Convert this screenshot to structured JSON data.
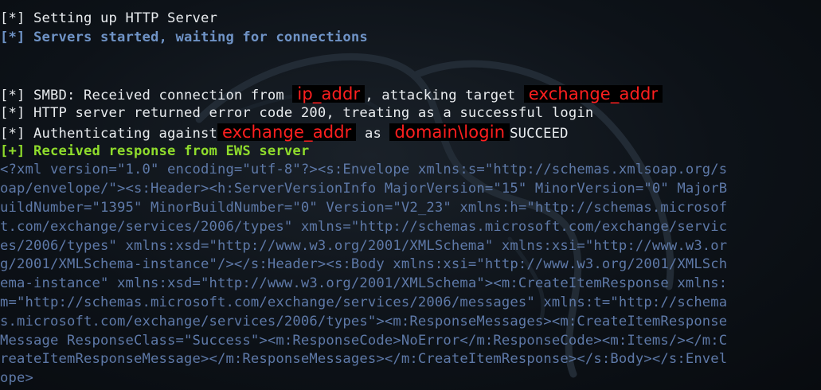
{
  "colors": {
    "background": "#0b0f14",
    "white_text": "#e9ecef",
    "status_blue": "#6f93c6",
    "success_green": "#8fdc2c",
    "xml_text": "#5e79a8",
    "redaction_text": "#ff1f1f"
  },
  "lines": {
    "l1": "[*] Setting up HTTP Server",
    "l2": "[*] Servers started, waiting for connections",
    "l3a": "[*] SMBD: Received connection from ",
    "l3b": "ip_addr",
    "l3c": ", attacking target ",
    "l3d": "exchange_addr",
    "l4": "[*] HTTP server returned error code 200, treating as a successful login",
    "l5a": "[*] Authenticating against",
    "l5b": "exchange_addr",
    "l5c": " as ",
    "l5d": "domain\\login",
    "l5e": "SUCCEED",
    "l6": "[+] Received response from EWS server"
  },
  "xml_response": [
    "<?xml version=\"1.0\" encoding=\"utf-8\"?><s:Envelope xmlns:s=\"http://schemas.xmlsoap.org/s",
    "oap/envelope/\"><s:Header><h:ServerVersionInfo MajorVersion=\"15\" MinorVersion=\"0\" MajorB",
    "uildNumber=\"1395\" MinorBuildNumber=\"0\" Version=\"V2_23\" xmlns:h=\"http://schemas.microsof",
    "t.com/exchange/services/2006/types\" xmlns=\"http://schemas.microsoft.com/exchange/servic",
    "es/2006/types\" xmlns:xsd=\"http://www.w3.org/2001/XMLSchema\" xmlns:xsi=\"http://www.w3.or",
    "g/2001/XMLSchema-instance\"/></s:Header><s:Body xmlns:xsi=\"http://www.w3.org/2001/XMLSch",
    "ema-instance\" xmlns:xsd=\"http://www.w3.org/2001/XMLSchema\"><m:CreateItemResponse xmlns:",
    "m=\"http://schemas.microsoft.com/exchange/services/2006/messages\" xmlns:t=\"http://schema",
    "s.microsoft.com/exchange/services/2006/types\"><m:ResponseMessages><m:CreateItemResponse",
    "Message ResponseClass=\"Success\"><m:ResponseCode>NoError</m:ResponseCode><m:Items/></m:C",
    "reateItemResponseMessage></m:ResponseMessages></m:CreateItemResponse></s:Body></s:Envel",
    "ope>"
  ]
}
